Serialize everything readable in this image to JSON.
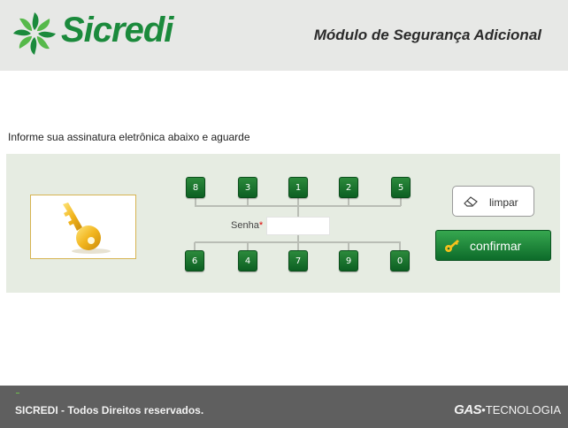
{
  "header": {
    "brand": "Sicredi",
    "module_title": "Módulo de Segurança Adicional"
  },
  "instruction": "Informe sua assinatura eletrônica abaixo e aguarde",
  "keypad": {
    "top_row": [
      "8",
      "3",
      "1",
      "2",
      "5"
    ],
    "bottom_row": [
      "6",
      "4",
      "7",
      "9",
      "0"
    ]
  },
  "password": {
    "label": "Senha",
    "required_mark": "*",
    "value": "",
    "placeholder": ""
  },
  "buttons": {
    "clear_label": "limpar",
    "confirm_label": "confirmar"
  },
  "footer": {
    "copyright": "SICREDI -  Todos Direitos reservados.",
    "vendor_gas": "GAS",
    "vendor_sep": "•",
    "vendor_rest": "TECNOLOGIA"
  },
  "colors": {
    "brand_green": "#1b8a3c",
    "button_green": "#0c5f22",
    "header_bg": "#e7e8e6",
    "panel_bg": "#e6ece2",
    "footer_bg": "#5f5f5f"
  },
  "icons": [
    "sicredi-logo-icon",
    "key-icon",
    "eraser-icon",
    "small-key-icon"
  ]
}
